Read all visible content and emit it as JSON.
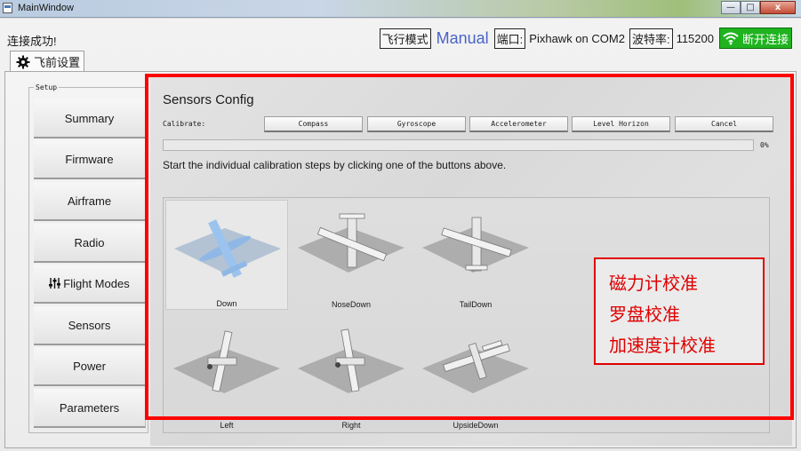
{
  "window": {
    "title": "MainWindow",
    "controls": {
      "minimize": "—",
      "maximize": "□",
      "close": "x"
    }
  },
  "status": {
    "connection_message": "连接成功!",
    "flight_mode_label": "飞行模式",
    "flight_mode_value": "Manual",
    "port_label": "端口:",
    "port_value": "Pixhawk on COM2",
    "baud_label": "波特率:",
    "baud_value": "115200",
    "disconnect_label": "断开连接"
  },
  "tab": {
    "label": "飞前设置"
  },
  "setup": {
    "title": "Setup",
    "items": [
      {
        "label": "Summary"
      },
      {
        "label": "Firmware"
      },
      {
        "label": "Airframe"
      },
      {
        "label": "Radio"
      },
      {
        "label": "Flight Modes"
      },
      {
        "label": "Sensors"
      },
      {
        "label": "Power"
      },
      {
        "label": "Parameters"
      }
    ]
  },
  "sensors": {
    "title": "Sensors Config",
    "calibrate_label": "Calibrate:",
    "buttons": [
      "Compass",
      "Gyroscope",
      "Accelerometer",
      "Level Horizon",
      "Cancel"
    ],
    "progress_percent": 0,
    "progress_text": "0%",
    "instructions": "Start the individual calibration steps by clicking one of the buttons above.",
    "orientations": [
      "Down",
      "NoseDown",
      "TailDown",
      "Left",
      "Right",
      "UpsideDown"
    ],
    "active_orientation": "Down"
  },
  "annotation": {
    "lines": [
      "磁力计校准",
      "罗盘校准",
      "加速度计校准"
    ],
    "color": "#ff0000"
  },
  "colors": {
    "accent_mode": "#4a63c8",
    "connect_green": "#20b320",
    "progress_blue": "#3b8ad9"
  }
}
